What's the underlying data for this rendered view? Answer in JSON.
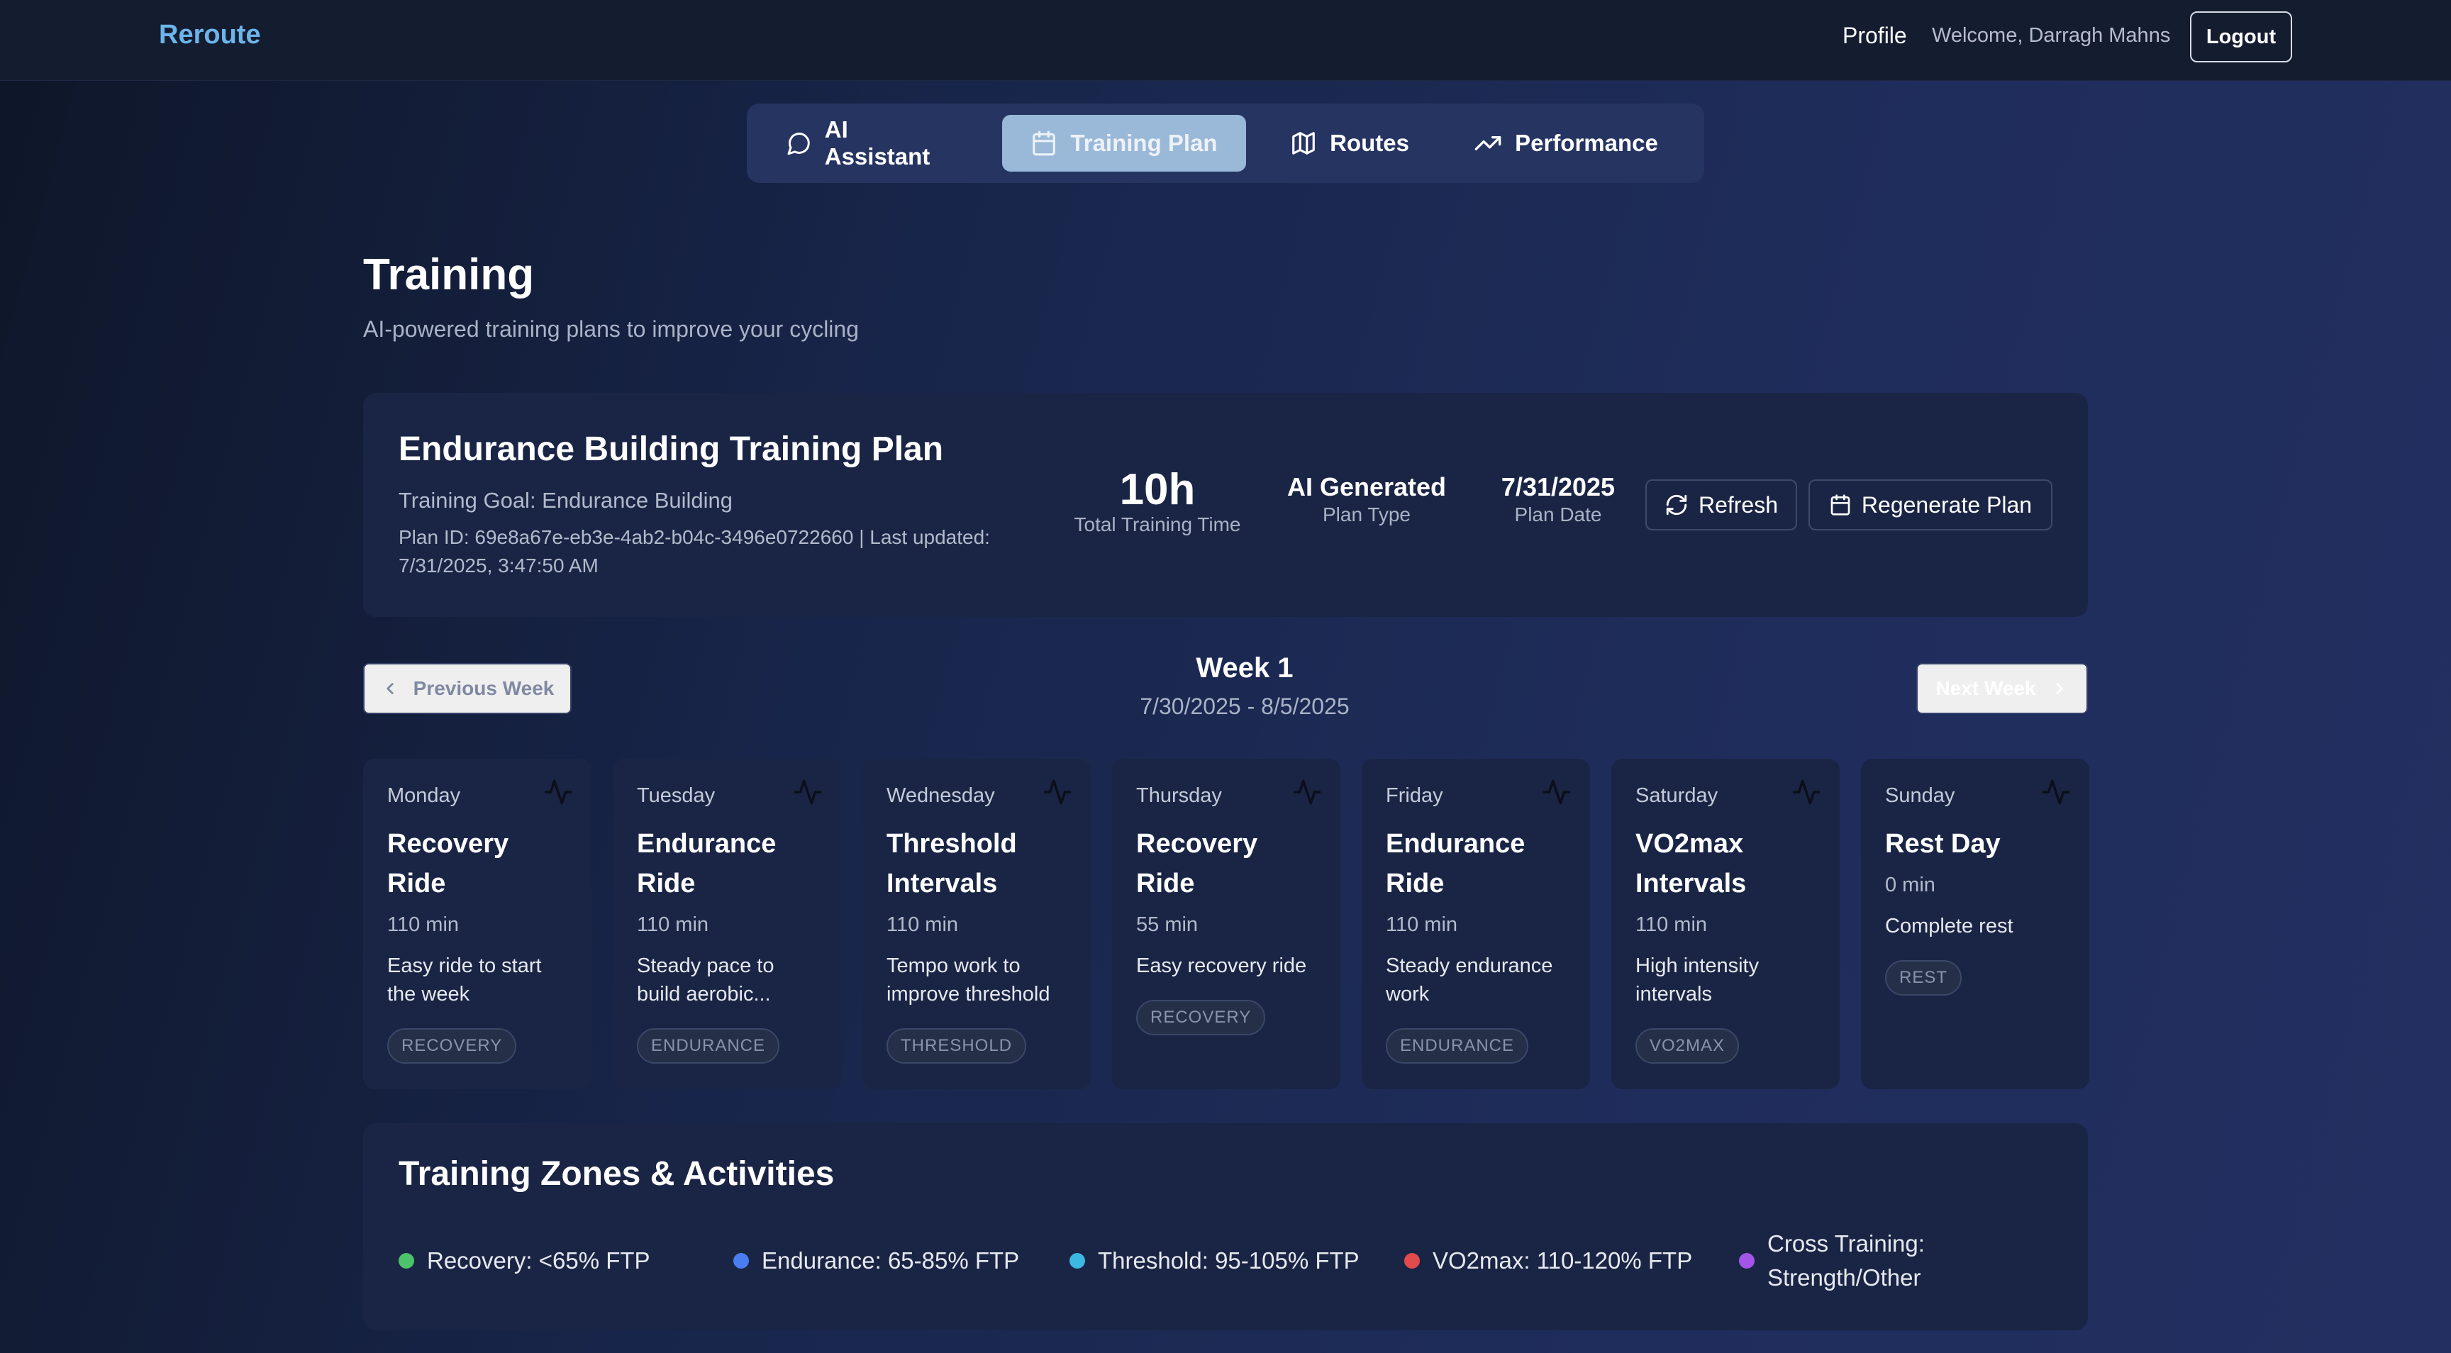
{
  "header": {
    "brand": "Reroute",
    "profile_link": "Profile",
    "welcome": "Welcome, Darragh Mahns",
    "logout_label": "Logout"
  },
  "tabs": [
    {
      "label": "AI Assistant",
      "icon": "chat-bubble-icon",
      "active": false
    },
    {
      "label": "Training Plan",
      "icon": "calendar-icon",
      "active": true
    },
    {
      "label": "Routes",
      "icon": "map-icon",
      "active": false
    },
    {
      "label": "Performance",
      "icon": "trending-up-icon",
      "active": false
    }
  ],
  "page": {
    "title": "Training",
    "subtitle": "AI-powered training plans to improve your cycling"
  },
  "plan": {
    "title": "Endurance Building Training Plan",
    "goal": "Training Goal: Endurance Building",
    "meta": "Plan ID: 69e8a67e-eb3e-4ab2-b04c-3496e0722660 | Last updated: 7/31/2025, 3:47:50 AM",
    "total_time_value": "10h",
    "total_time_label": "Total Training Time",
    "plan_type_value": "AI Generated",
    "plan_type_label": "Plan Type",
    "plan_date_value": "7/31/2025",
    "plan_date_label": "Plan Date",
    "refresh_label": "Refresh",
    "regenerate_label": "Regenerate Plan"
  },
  "week": {
    "prev_label": "Previous Week",
    "next_label": "Next Week",
    "title": "Week 1",
    "range": "7/30/2025 - 8/5/2025",
    "days": [
      {
        "day": "Monday",
        "title": "Recovery Ride",
        "duration": "110 min",
        "description": "Easy ride to start the week",
        "tag": "RECOVERY"
      },
      {
        "day": "Tuesday",
        "title": "Endurance Ride",
        "duration": "110 min",
        "description": "Steady pace to build aerobic...",
        "tag": "ENDURANCE"
      },
      {
        "day": "Wednesday",
        "title": "Threshold Intervals",
        "duration": "110 min",
        "description": "Tempo work to improve threshold",
        "tag": "THRESHOLD"
      },
      {
        "day": "Thursday",
        "title": "Recovery Ride",
        "duration": "55 min",
        "description": "Easy recovery ride",
        "tag": "RECOVERY"
      },
      {
        "day": "Friday",
        "title": "Endurance Ride",
        "duration": "110 min",
        "description": "Steady endurance work",
        "tag": "ENDURANCE"
      },
      {
        "day": "Saturday",
        "title": "VO2max Intervals",
        "duration": "110 min",
        "description": "High intensity intervals",
        "tag": "VO2MAX"
      },
      {
        "day": "Sunday",
        "title": "Rest Day",
        "duration": "0 min",
        "description": "Complete rest",
        "tag": "REST"
      }
    ]
  },
  "zones": {
    "title": "Training Zones & Activities",
    "items": [
      {
        "label": "Recovery: <65% FTP",
        "color": "#4cc26a"
      },
      {
        "label": "Endurance: 65-85% FTP",
        "color": "#4a7ef0"
      },
      {
        "label": "Threshold: 95-105% FTP",
        "color": "#3db8e0"
      },
      {
        "label": "VO2max: 110-120% FTP",
        "color": "#e24b4b"
      },
      {
        "label": "Cross Training: Strength/Other",
        "color": "#a355e8"
      }
    ]
  }
}
